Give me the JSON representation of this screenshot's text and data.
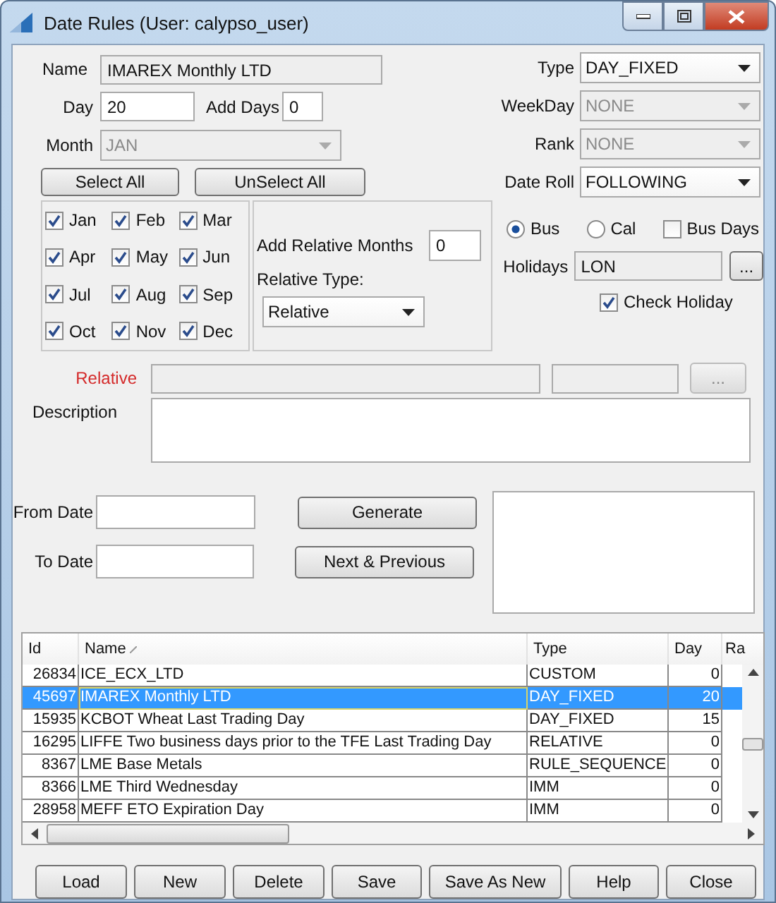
{
  "window": {
    "title": "Date Rules (User: calypso_user)"
  },
  "name": {
    "label": "Name",
    "value": "IMAREX Monthly LTD"
  },
  "day": {
    "label": "Day",
    "value": "20"
  },
  "add_days": {
    "label": "Add Days",
    "value": "0"
  },
  "month": {
    "label": "Month",
    "value": "JAN",
    "disabled": true
  },
  "select_all": "Select All",
  "unselect_all": "UnSelect All",
  "months": [
    {
      "label": "Jan",
      "checked": true
    },
    {
      "label": "Feb",
      "checked": true
    },
    {
      "label": "Mar",
      "checked": true
    },
    {
      "label": "Apr",
      "checked": true
    },
    {
      "label": "May",
      "checked": true
    },
    {
      "label": "Jun",
      "checked": true
    },
    {
      "label": "Jul",
      "checked": true
    },
    {
      "label": "Aug",
      "checked": true
    },
    {
      "label": "Sep",
      "checked": true
    },
    {
      "label": "Oct",
      "checked": true
    },
    {
      "label": "Nov",
      "checked": true
    },
    {
      "label": "Dec",
      "checked": true
    }
  ],
  "add_relative_months": {
    "label": "Add Relative Months",
    "value": "0"
  },
  "relative_type": {
    "label": "Relative Type:",
    "value": "Relative"
  },
  "selects": [
    {
      "label": "Type",
      "value": "DAY_FIXED",
      "disabled": false
    },
    {
      "label": "WeekDay",
      "value": "NONE",
      "disabled": true
    },
    {
      "label": "Rank",
      "value": "NONE",
      "disabled": true
    },
    {
      "label": "Date Roll",
      "value": "FOLLOWING",
      "disabled": false
    }
  ],
  "day_basis": [
    {
      "label": "Bus",
      "selected": true
    },
    {
      "label": "Cal",
      "selected": false
    }
  ],
  "bus_days": {
    "label": "Bus Days",
    "checked": false
  },
  "holidays": {
    "label": "Holidays",
    "value": "LON",
    "button": "..."
  },
  "check_holiday": {
    "label": "Check Holiday",
    "checked": true
  },
  "relative": {
    "label": "Relative",
    "button": "..."
  },
  "description": {
    "label": "Description"
  },
  "from_date": {
    "label": "From Date"
  },
  "to_date": {
    "label": "To Date"
  },
  "generate": "Generate",
  "next_previous": "Next & Previous",
  "table": {
    "columns": [
      "Id",
      "Name",
      "Type",
      "Day",
      "Ra"
    ],
    "rows": [
      {
        "cells": [
          "26834",
          "ICE_ECX_LTD",
          "CUSTOM",
          "0"
        ],
        "selected": false
      },
      {
        "cells": [
          "45697",
          "IMAREX Monthly LTD",
          "DAY_FIXED",
          "20"
        ],
        "selected": true
      },
      {
        "cells": [
          "15935",
          "KCBOT Wheat Last Trading Day",
          "DAY_FIXED",
          "15"
        ],
        "selected": false
      },
      {
        "cells": [
          "16295",
          "LIFFE Two business days prior to the TFE Last Trading Day",
          "RELATIVE",
          "0"
        ],
        "selected": false
      },
      {
        "cells": [
          "8367",
          "LME Base Metals",
          "RULE_SEQUENCE",
          "0"
        ],
        "selected": false
      },
      {
        "cells": [
          "8366",
          "LME Third Wednesday",
          "IMM",
          "0"
        ],
        "selected": false
      },
      {
        "cells": [
          "28958",
          "MEFF ETO Expiration Day",
          "IMM",
          "0"
        ],
        "selected": false
      }
    ]
  },
  "buttons": [
    "Load",
    "New",
    "Delete",
    "Save",
    "Save As New",
    "Help",
    "Close"
  ]
}
